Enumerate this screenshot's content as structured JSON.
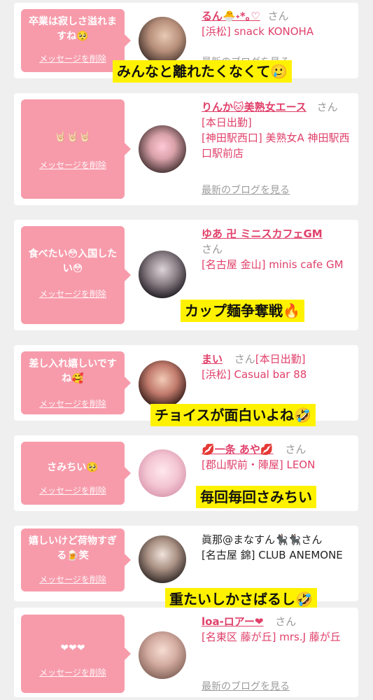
{
  "common": {
    "delete_label": "メッセージを削除",
    "blog_label": "最新のブログを見る",
    "san": "さん"
  },
  "cards": [
    {
      "message": "卒業は寂しさ溢れますね🥺",
      "name": "るん🐣˖*｡♡",
      "shop": "[浜松] snack KONOHA",
      "caption": "みんなと離れたくなくて🥲"
    },
    {
      "message": "🤘🏻🤘🏻🤘🏻",
      "name": "りんか🐱美熟女エース",
      "shop": "[本日出勤]",
      "shop2": "[神田駅西口] 美熟女A 神田駅西口駅前店"
    },
    {
      "message": "食べたい😳入国したい😳",
      "name": "ゆあ 卍 ミニスカフェGM",
      "shop": "[名古屋 金山] minis cafe GM",
      "caption": "カップ麺争奪戦🔥"
    },
    {
      "message": "差し入れ嬉しいですね🥰",
      "name": "まい",
      "shop": "[本日出勤]",
      "shop2": "[浜松] Casual bar 88",
      "caption": "チョイスが面白いよね🤣"
    },
    {
      "message": "さみちい🥺",
      "name": "💋一条 あや💋",
      "shop": "[郡山駅前・陣屋] LEON",
      "caption": "毎回毎回さみちい"
    },
    {
      "message": "嬉しいけど荷物すぎる🍺笑",
      "name": "眞那@まなすん🐈‍⬛🐈‍⬛",
      "shop": "[名古屋 錦] CLUB ANEMONE",
      "caption": "重たいしかさばるし🤣"
    },
    {
      "message": "❤❤❤",
      "name": "loa-ロアー❤",
      "shop": "[名東区 藤が丘] mrs.J 藤が丘"
    }
  ]
}
